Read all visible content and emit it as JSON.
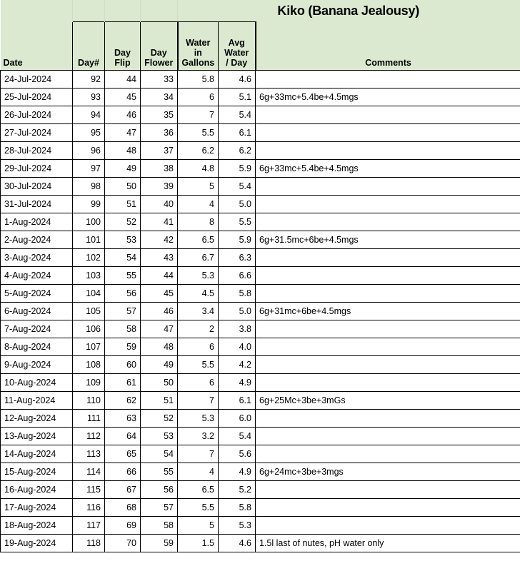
{
  "title": "Kiko (Banana Jealousy)",
  "columns": {
    "date": "Date",
    "day_num": "Day#",
    "day_flip": "Day\nFlip",
    "day_flip_l1": "Day",
    "day_flip_l2": "Flip",
    "day_flower_l1": "Day",
    "day_flower_l2": "Flower",
    "water_l1": "Water",
    "water_l2": "in",
    "water_l3": "Gallons",
    "avg_l1": "Avg",
    "avg_l2": "Water",
    "avg_l3": "/ Day",
    "comments": "Comments"
  },
  "colors": {
    "header_green": "#dbe9d0",
    "avg_column_grey": "#f0f0f0",
    "grid_line": "#000000"
  },
  "rows": [
    {
      "date": "24-Jul-2024",
      "day": "92",
      "flip": "44",
      "flower": "33",
      "water": "5.8",
      "avg": "4.6",
      "comment": ""
    },
    {
      "date": "25-Jul-2024",
      "day": "93",
      "flip": "45",
      "flower": "34",
      "water": "6",
      "avg": "5.1",
      "comment": "6g+33mc+5.4be+4.5mgs"
    },
    {
      "date": "26-Jul-2024",
      "day": "94",
      "flip": "46",
      "flower": "35",
      "water": "7",
      "avg": "5.4",
      "comment": ""
    },
    {
      "date": "27-Jul-2024",
      "day": "95",
      "flip": "47",
      "flower": "36",
      "water": "5.5",
      "avg": "6.1",
      "comment": ""
    },
    {
      "date": "28-Jul-2024",
      "day": "96",
      "flip": "48",
      "flower": "37",
      "water": "6.2",
      "avg": "6.2",
      "comment": ""
    },
    {
      "date": "29-Jul-2024",
      "day": "97",
      "flip": "49",
      "flower": "38",
      "water": "4.8",
      "avg": "5.9",
      "comment": "6g+33mc+5.4be+4.5mgs"
    },
    {
      "date": "30-Jul-2024",
      "day": "98",
      "flip": "50",
      "flower": "39",
      "water": "5",
      "avg": "5.4",
      "comment": ""
    },
    {
      "date": "31-Jul-2024",
      "day": "99",
      "flip": "51",
      "flower": "40",
      "water": "4",
      "avg": "5.0",
      "comment": ""
    },
    {
      "date": "1-Aug-2024",
      "day": "100",
      "flip": "52",
      "flower": "41",
      "water": "8",
      "avg": "5.5",
      "comment": ""
    },
    {
      "date": "2-Aug-2024",
      "day": "101",
      "flip": "53",
      "flower": "42",
      "water": "6.5",
      "avg": "5.9",
      "comment": "6g+31.5mc+6be+4.5mgs"
    },
    {
      "date": "3-Aug-2024",
      "day": "102",
      "flip": "54",
      "flower": "43",
      "water": "6.7",
      "avg": "6.3",
      "comment": ""
    },
    {
      "date": "4-Aug-2024",
      "day": "103",
      "flip": "55",
      "flower": "44",
      "water": "5.3",
      "avg": "6.6",
      "comment": ""
    },
    {
      "date": "5-Aug-2024",
      "day": "104",
      "flip": "56",
      "flower": "45",
      "water": "4.5",
      "avg": "5.8",
      "comment": ""
    },
    {
      "date": "6-Aug-2024",
      "day": "105",
      "flip": "57",
      "flower": "46",
      "water": "3.4",
      "avg": "5.0",
      "comment": "6g+31mc+6be+4.5mgs"
    },
    {
      "date": "7-Aug-2024",
      "day": "106",
      "flip": "58",
      "flower": "47",
      "water": "2",
      "avg": "3.8",
      "comment": ""
    },
    {
      "date": "8-Aug-2024",
      "day": "107",
      "flip": "59",
      "flower": "48",
      "water": "6",
      "avg": "4.0",
      "comment": ""
    },
    {
      "date": "9-Aug-2024",
      "day": "108",
      "flip": "60",
      "flower": "49",
      "water": "5.5",
      "avg": "4.2",
      "comment": ""
    },
    {
      "date": "10-Aug-2024",
      "day": "109",
      "flip": "61",
      "flower": "50",
      "water": "6",
      "avg": "4.9",
      "comment": ""
    },
    {
      "date": "11-Aug-2024",
      "day": "110",
      "flip": "62",
      "flower": "51",
      "water": "7",
      "avg": "6.1",
      "comment": "6g+25Mc+3be+3mGs"
    },
    {
      "date": "12-Aug-2024",
      "day": "111",
      "flip": "63",
      "flower": "52",
      "water": "5.3",
      "avg": "6.0",
      "comment": ""
    },
    {
      "date": "13-Aug-2024",
      "day": "112",
      "flip": "64",
      "flower": "53",
      "water": "3.2",
      "avg": "5.4",
      "comment": ""
    },
    {
      "date": "14-Aug-2024",
      "day": "113",
      "flip": "65",
      "flower": "54",
      "water": "7",
      "avg": "5.6",
      "comment": ""
    },
    {
      "date": "15-Aug-2024",
      "day": "114",
      "flip": "66",
      "flower": "55",
      "water": "4",
      "avg": "4.9",
      "comment": "6g+24mc+3be+3mgs"
    },
    {
      "date": "16-Aug-2024",
      "day": "115",
      "flip": "67",
      "flower": "56",
      "water": "6.5",
      "avg": "5.2",
      "comment": ""
    },
    {
      "date": "17-Aug-2024",
      "day": "116",
      "flip": "68",
      "flower": "57",
      "water": "5.5",
      "avg": "5.8",
      "comment": ""
    },
    {
      "date": "18-Aug-2024",
      "day": "117",
      "flip": "69",
      "flower": "58",
      "water": "5",
      "avg": "5.3",
      "comment": ""
    },
    {
      "date": "19-Aug-2024",
      "day": "118",
      "flip": "70",
      "flower": "59",
      "water": "1.5",
      "avg": "4.6",
      "comment": "1.5l last of nutes, pH water only"
    }
  ]
}
